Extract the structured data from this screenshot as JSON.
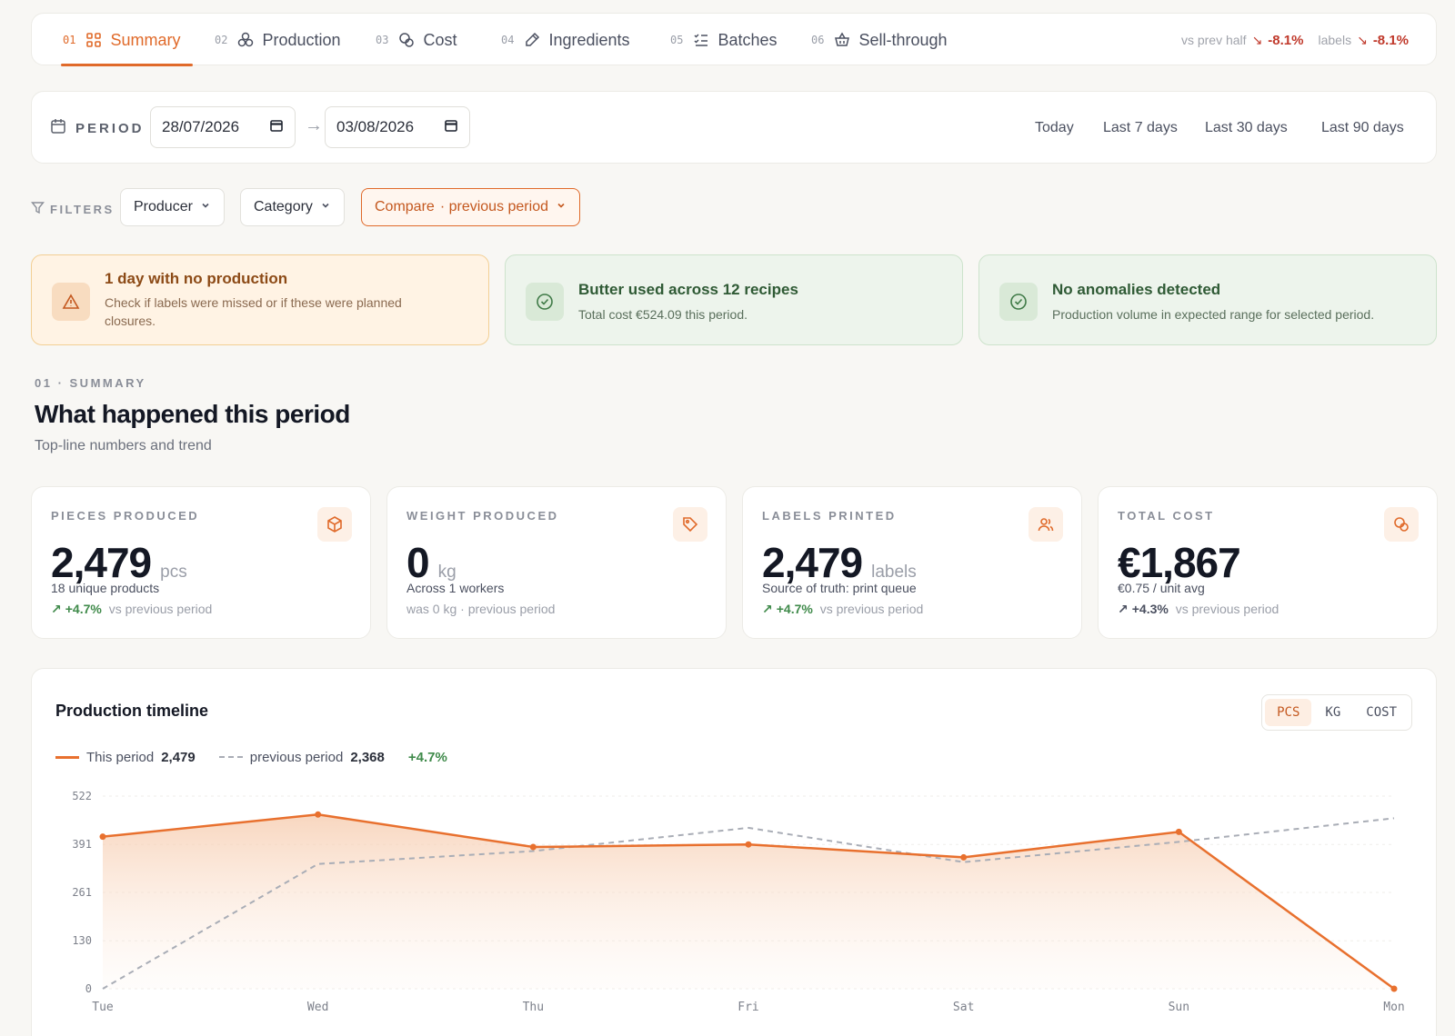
{
  "tabs": [
    {
      "num": "01",
      "label": "Summary",
      "icon": "grid-icon",
      "active": true
    },
    {
      "num": "02",
      "label": "Production",
      "icon": "cubes-icon"
    },
    {
      "num": "03",
      "label": "Cost",
      "icon": "coins-icon"
    },
    {
      "num": "04",
      "label": "Ingredients",
      "icon": "pipette-icon"
    },
    {
      "num": "05",
      "label": "Batches",
      "icon": "checklist-icon"
    },
    {
      "num": "06",
      "label": "Sell-through",
      "icon": "basket-icon"
    }
  ],
  "header_deltas": {
    "vs_label": "vs prev half",
    "vs_value": "-8.1%",
    "labels_label": "labels",
    "labels_value": "-8.1%"
  },
  "period": {
    "label": "PERIOD",
    "from": "28/07/2026",
    "to": "03/08/2026",
    "quick": [
      "Today",
      "Last 7 days",
      "Last 30 days",
      "Last 90 days"
    ]
  },
  "filters": {
    "label": "FILTERS",
    "producer": "Producer",
    "category": "Category",
    "compare": "Compare",
    "compare_value": "· previous period"
  },
  "alerts": [
    {
      "type": "warn",
      "title": "1 day with no production",
      "text": "Check if labels were missed or if these were planned closures."
    },
    {
      "type": "ok",
      "title": "Butter used across 12 recipes",
      "text": "Total cost €524.09 this period."
    },
    {
      "type": "ok",
      "title": "No anomalies detected",
      "text": "Production volume in expected range for selected period."
    }
  ],
  "section": {
    "kicker": "01 · SUMMARY",
    "title": "What happened this period",
    "subtitle": "Top-line numbers and trend"
  },
  "kpis": [
    {
      "label": "PIECES PRODUCED",
      "icon": "box-icon",
      "value": "2,479",
      "unit": "pcs",
      "sub": "18 unique products",
      "delta": "+4.7%",
      "delta_text": "vs previous period"
    },
    {
      "label": "WEIGHT PRODUCED",
      "icon": "tag-icon",
      "value": "0",
      "unit": "kg",
      "sub": "Across 1 workers",
      "delta": "",
      "delta_text": "was 0 kg · previous period"
    },
    {
      "label": "LABELS PRINTED",
      "icon": "users-icon",
      "value": "2,479",
      "unit": "labels",
      "sub": "Source of truth: print queue",
      "delta": "+4.7%",
      "delta_text": "vs previous period"
    },
    {
      "label": "TOTAL COST",
      "icon": "coins-icon",
      "value": "€1,867",
      "unit": "",
      "sub": "€0.75 / unit avg",
      "delta": "+4.3%",
      "delta_text": "vs previous period"
    }
  ],
  "chart_card": {
    "title": "Production timeline",
    "toggles": [
      "PCS",
      "KG",
      "COST"
    ],
    "active_toggle": "PCS",
    "legend_this": "This period",
    "legend_this_total": "2,479",
    "legend_prev": "previous period",
    "legend_prev_total": "2,368",
    "legend_delta": "+4.7%"
  },
  "chart_data": {
    "type": "line",
    "categories": [
      "Tue",
      "Wed",
      "Thu",
      "Fri",
      "Sat",
      "Sun",
      "Mon"
    ],
    "series": [
      {
        "name": "This period",
        "values": [
          412,
          472,
          384,
          391,
          356,
          425,
          0
        ],
        "color": "#e8702e"
      },
      {
        "name": "previous period",
        "values": [
          0,
          338,
          373,
          436,
          343,
          398,
          462
        ],
        "color": "#a9adb6"
      }
    ],
    "yticks": [
      0,
      130,
      261,
      391,
      522
    ],
    "ylim": [
      0,
      522
    ]
  },
  "colors": {
    "accent": "#e06a2a",
    "positive": "#3f8a4a",
    "negative": "#c0392b"
  }
}
